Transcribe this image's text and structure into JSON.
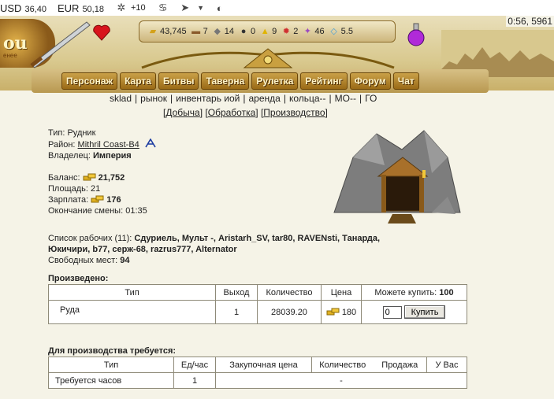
{
  "topbar": {
    "currencies": [
      {
        "code": "USD",
        "value": "36,40"
      },
      {
        "code": "EUR",
        "value": "50,18"
      }
    ],
    "weather_delta": "+10",
    "timer": "0:56, 5961"
  },
  "resources": [
    {
      "icon": "gold-icon",
      "value": "43,745"
    },
    {
      "icon": "wood-icon",
      "value": "7"
    },
    {
      "icon": "ore-icon",
      "value": "14"
    },
    {
      "icon": "coal-icon",
      "value": "0"
    },
    {
      "icon": "sulfur-icon",
      "value": "9"
    },
    {
      "icon": "crystal-icon",
      "value": "2"
    },
    {
      "icon": "mercury-icon",
      "value": "46"
    },
    {
      "icon": "diamond-icon",
      "value": "5.5"
    }
  ],
  "logo": {
    "text": "ou",
    "sub": "енее"
  },
  "nav": [
    "Персонаж",
    "Карта",
    "Битвы",
    "Таверна",
    "Рулетка",
    "Рейтинг",
    "Форум",
    "Чат"
  ],
  "sublinks": [
    "sklad",
    "рынок",
    "инвентарь иой",
    "аренда",
    "кольца--",
    "МО--",
    "ГО"
  ],
  "tabs": [
    "Добыча",
    "Обработка",
    "Производство"
  ],
  "mine": {
    "type_label": "Тип:",
    "type_value": "Рудник",
    "region_label": "Район:",
    "region_value": "Mithril Coast-B4",
    "owner_label": "Владелец:",
    "owner_value": "Империя",
    "balance_label": "Баланс:",
    "balance_value": "21,752",
    "area_label": "Площадь:",
    "area_value": "21",
    "salary_label": "Зарплата:",
    "salary_value": "176",
    "shift_label": "Окончание смены:",
    "shift_value": "01:35",
    "workers_label": "Список рабочих (11):",
    "workers_line1": "Сдуриель, Мульт -, Aristarh_SV, tar80, RAVENsti, Танарда,",
    "workers_line2": "Юкичири, b77, серж-68, razrus777, Alternator",
    "free_label": "Свободных мест:",
    "free_value": "94"
  },
  "produced": {
    "title": "Произведено:",
    "headers": [
      "Тип",
      "Выход",
      "Количество",
      "Цена"
    ],
    "can_buy_label": "Можете купить:",
    "can_buy_value": "100",
    "row": {
      "type": "Руда",
      "output": "1",
      "quantity": "28039.20",
      "price": "180",
      "input_value": "0",
      "buy_label": "Купить"
    }
  },
  "required": {
    "title": "Для производства требуется:",
    "headers": [
      "Тип",
      "Ед/час",
      "Закупочная цена",
      "Количество",
      "Продажа",
      "У Вас"
    ],
    "row": {
      "type": "Требуется часов",
      "per_hour": "1",
      "price": "-"
    }
  },
  "colors": {
    "nav_gold": "#b07c1e",
    "background": "#f5f3e7"
  }
}
